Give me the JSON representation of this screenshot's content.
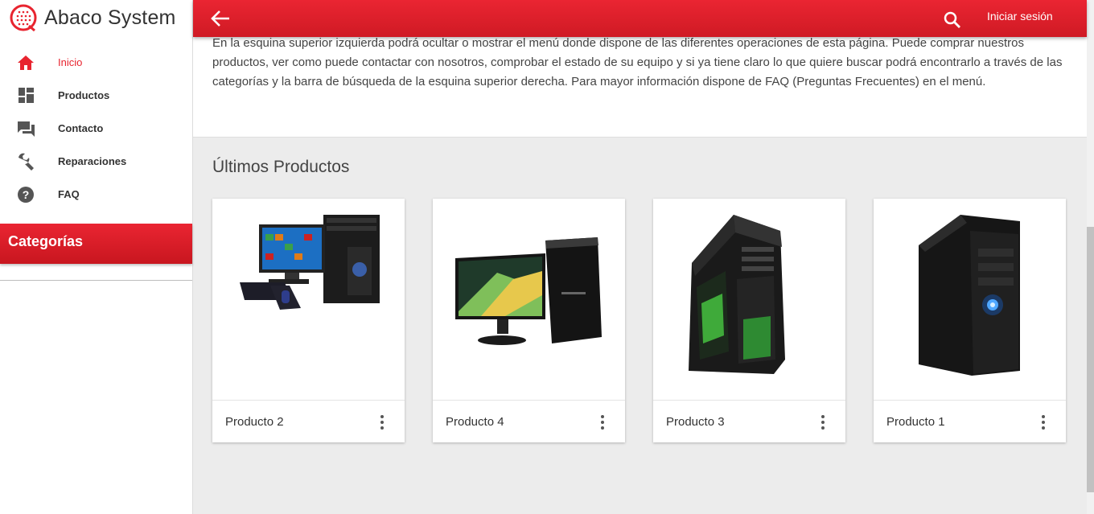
{
  "brand": {
    "name": "Abaco System",
    "accent": "#e8242f"
  },
  "sidebar": {
    "items": [
      {
        "label": "Inicio",
        "icon": "home-icon",
        "active": true
      },
      {
        "label": "Productos",
        "icon": "dashboard-icon",
        "active": false
      },
      {
        "label": "Contacto",
        "icon": "chat-icon",
        "active": false
      },
      {
        "label": "Reparaciones",
        "icon": "wrench-icon",
        "active": false
      },
      {
        "label": "FAQ",
        "icon": "help-icon",
        "active": false
      }
    ],
    "categories_title": "Categorías"
  },
  "topbar": {
    "back_icon": "arrow-left-icon",
    "search_icon": "search-icon",
    "login_label": "Iniciar sesión"
  },
  "intro": {
    "text": "En la esquina superior izquierda podrá ocultar o mostrar el menú donde dispone de las diferentes operaciones de esta página. Puede comprar nuestros productos, ver como puede contactar con nosotros, comprobar el estado de su equipo y si ya tiene claro lo que quiere buscar podrá encontrarlo a través de las categorías y la barra de búsqueda de la esquina superior derecha. Para mayor información dispone de FAQ (Preguntas Frecuentes) en el menú."
  },
  "products": {
    "title": "Últimos Productos",
    "items": [
      {
        "name": "Producto 2",
        "image": "desktop-pc-with-monitor-keyboard"
      },
      {
        "name": "Producto 4",
        "image": "desktop-pc-with-widescreen-monitor"
      },
      {
        "name": "Producto 3",
        "image": "gaming-pc-tower-green"
      },
      {
        "name": "Producto 1",
        "image": "black-pc-tower-blue-light"
      }
    ]
  }
}
